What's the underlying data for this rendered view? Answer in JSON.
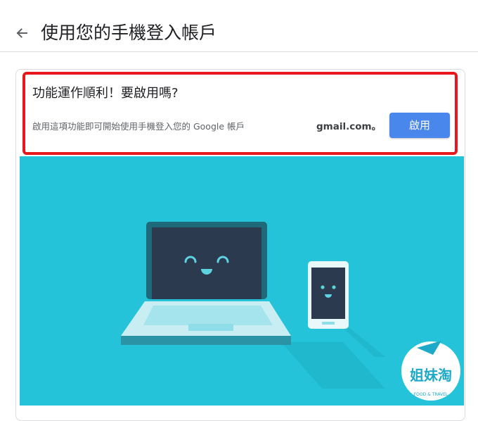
{
  "header": {
    "title": "使用您的手機登入帳戶",
    "back_icon": "arrow-left-icon"
  },
  "promo": {
    "title": "功能運作順利！要啟用嗎?",
    "description": "啟用這項功能即可開始使用手機登入您的 Google 帳戶",
    "email_suffix": "gmail.com。",
    "enable_label": "啟用"
  },
  "illustration": {
    "background_color": "#24c3d9",
    "device_screen_color": "#2b3a4e",
    "laptop_body_color": "#c8eef4"
  },
  "watermark": {
    "logo_text": "姐妹淘",
    "sub_text": "FOOD & TRAVEL"
  },
  "colors": {
    "accent": "#4a87ec",
    "highlight_border": "#e8171c"
  }
}
